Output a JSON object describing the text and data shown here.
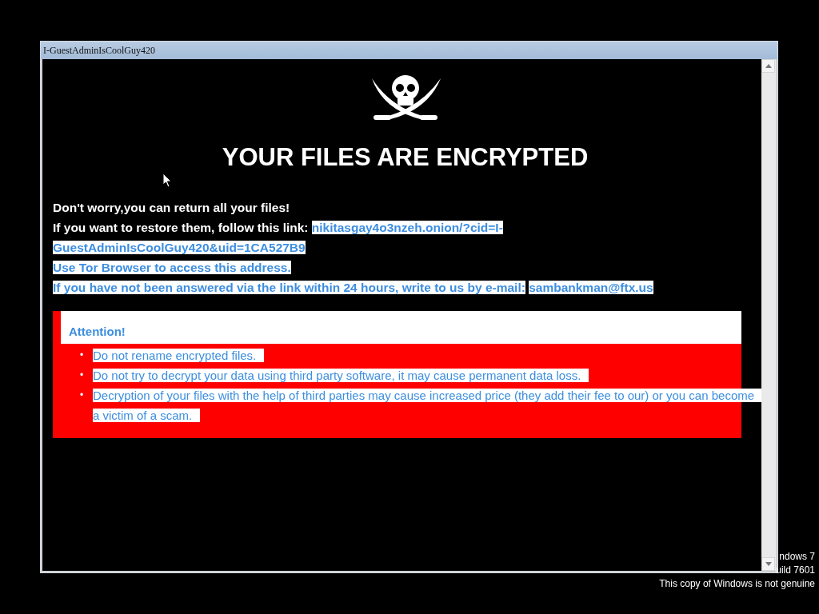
{
  "window": {
    "title": "I-GuestAdminIsCoolGuy420"
  },
  "note": {
    "heading": "YOUR FILES ARE ENCRYPTED",
    "paragraphs": [
      {
        "parts": [
          {
            "text": "Don't worry,you can return all your files!",
            "highlighted": false
          }
        ]
      },
      {
        "parts": [
          {
            "text": "If you want to restore them, follow this link:",
            "highlighted": false
          },
          {
            "text": "nikitasgay4o3nzeh.onion/?cid=I-",
            "highlighted": true
          }
        ]
      },
      {
        "parts": [
          {
            "text": "GuestAdminIsCoolGuy420&uid=1CA527B9",
            "highlighted": true
          }
        ]
      },
      {
        "parts": [
          {
            "text": "Use Tor Browser to access this address.",
            "highlighted": true
          }
        ]
      },
      {
        "parts": [
          {
            "text": "If you have not been answered via the link within 24 hours, write to us by e-mail:",
            "highlighted": true
          },
          {
            "text": "sambankman@ftx.us",
            "highlighted": true
          }
        ]
      }
    ]
  },
  "attention": {
    "title": "Attention!",
    "items": [
      {
        "marker": "•",
        "lines": [
          "Do not rename encrypted files."
        ]
      },
      {
        "marker": "•",
        "lines": [
          "Do not try to decrypt your data using third party software, it may cause permanent data loss."
        ]
      },
      {
        "marker": "•",
        "lines": [
          "Decryption of your files with the help of third parties may cause increased price (they add their fee to our) or you can become",
          "a victim of a scam."
        ]
      }
    ]
  },
  "desktop_notice": [
    "ndows 7",
    "uild 7601",
    "This copy of Windows is not genuine"
  ]
}
